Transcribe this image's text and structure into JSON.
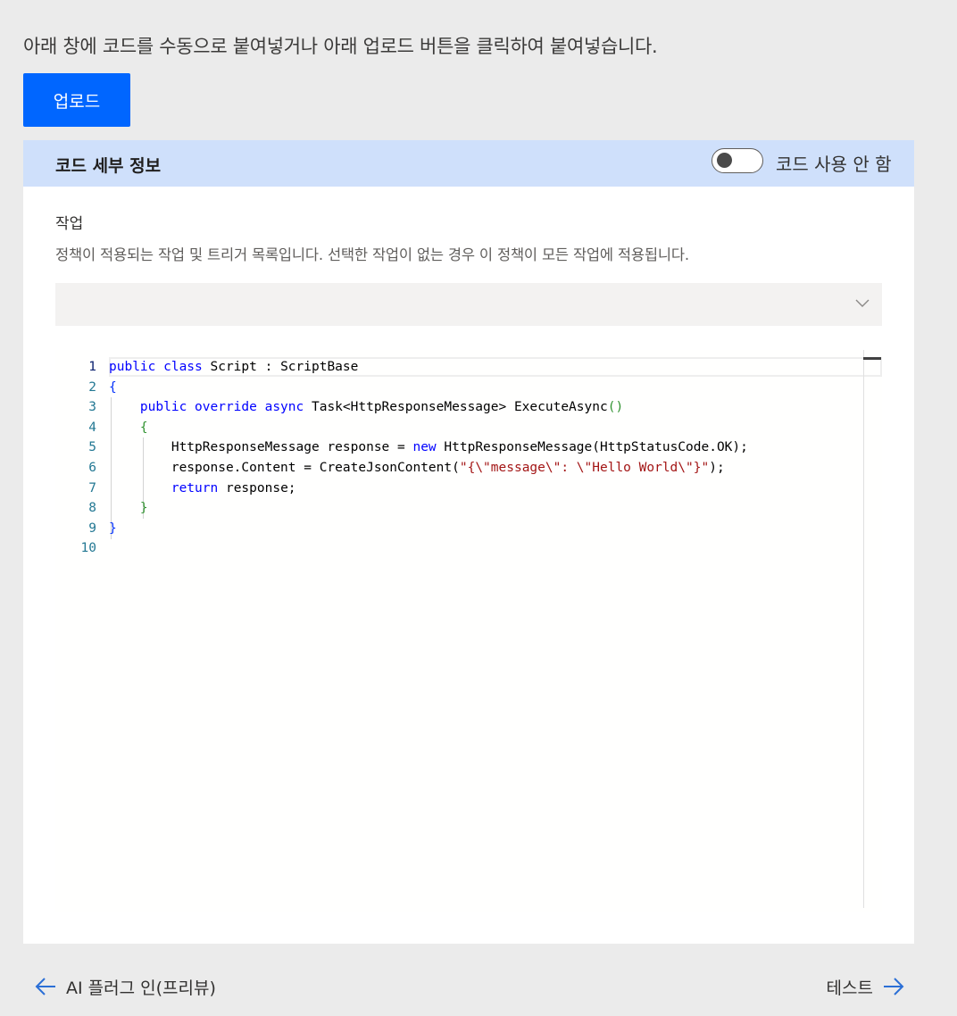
{
  "instruction": "아래 창에 코드를 수동으로 붙여넣거나 아래 업로드 버튼을 클릭하여 붙여넣습니다.",
  "upload_label": "업로드",
  "panel": {
    "title": "코드 세부 정보",
    "toggle_label": "코드 사용 안 함",
    "toggle_on": false,
    "field_label": "작업",
    "field_desc": "정책이 적용되는 작업 및 트리거 목록입니다. 선택한 작업이 없는 경우 이 정책이 모든 작업에 적용됩니다.",
    "dropdown_value": ""
  },
  "editor": {
    "line_numbers": [
      "1",
      "2",
      "3",
      "4",
      "5",
      "6",
      "7",
      "8",
      "9",
      "10"
    ],
    "lines": {
      "l1": {
        "a": "public class",
        "b": " Script : ScriptBase"
      },
      "l2": {
        "a": "{"
      },
      "l3": {
        "a": "public override async",
        "b": " Task<HttpResponseMessage> ExecuteAsync",
        "c": "()"
      },
      "l4": {
        "a": "{"
      },
      "l5": {
        "a": "HttpResponseMessage response = ",
        "b": "new",
        "c": " HttpResponseMessage(HttpStatusCode.OK);"
      },
      "l6": {
        "a": "response.Content = CreateJsonContent(",
        "b": "\"{\\\"message\\\": \\\"Hello World\\\"}\"",
        "c": ");"
      },
      "l7": {
        "a": "return",
        "b": " response;"
      },
      "l8": {
        "a": "}"
      },
      "l9": {
        "a": "}"
      }
    }
  },
  "nav": {
    "back_label": "AI 플러그 인(프리뷰)",
    "next_label": "테스트"
  },
  "colors": {
    "accent": "#0066ff",
    "header_bg": "#cfe0fb",
    "keyword": "#0000ff",
    "string": "#a31515",
    "arrow": "#2b6fd6"
  }
}
